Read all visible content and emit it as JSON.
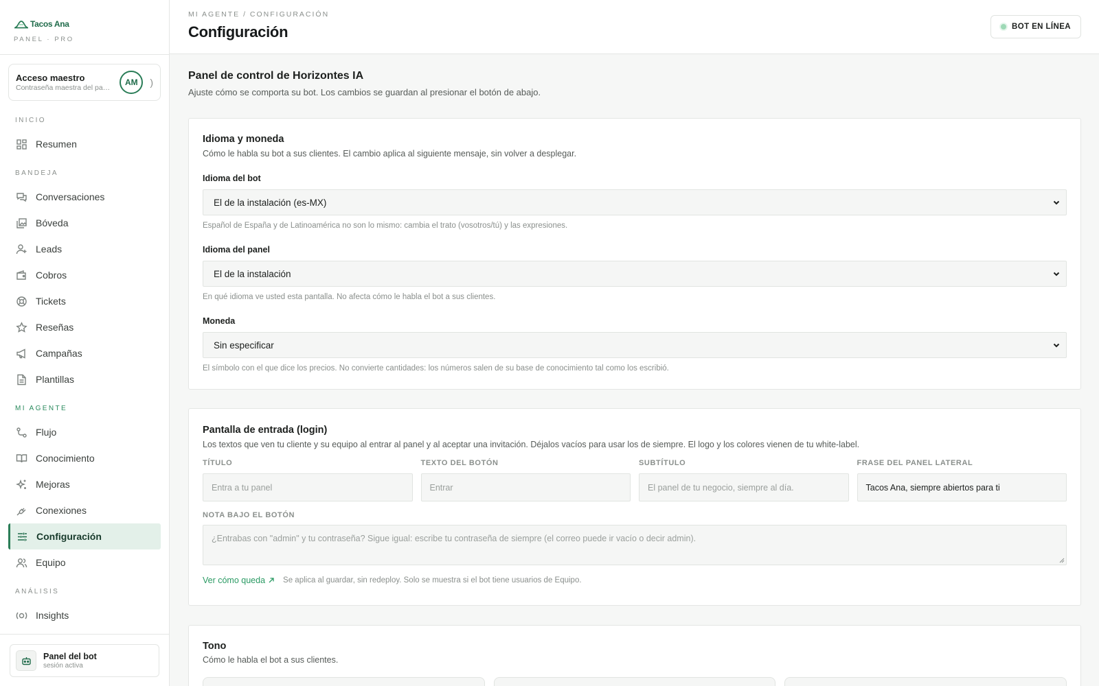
{
  "brand": {
    "name": "Tacos Ana",
    "subtitle": "PANEL · PRO"
  },
  "master_access": {
    "title": "Acceso maestro",
    "subtitle": "Contraseña maestra del panel",
    "initials": "AM",
    "trailing": ")"
  },
  "nav": {
    "sections": [
      {
        "label": "INICIO",
        "items": [
          {
            "label": "Resumen",
            "icon": "grid-icon"
          }
        ]
      },
      {
        "label": "BANDEJA",
        "items": [
          {
            "label": "Conversaciones",
            "icon": "chat-icon"
          },
          {
            "label": "Bóveda",
            "icon": "gallery-icon"
          },
          {
            "label": "Leads",
            "icon": "user-plus-icon"
          },
          {
            "label": "Cobros",
            "icon": "wallet-icon"
          },
          {
            "label": "Tickets",
            "icon": "lifebuoy-icon"
          },
          {
            "label": "Reseñas",
            "icon": "star-icon"
          },
          {
            "label": "Campañas",
            "icon": "megaphone-icon"
          },
          {
            "label": "Plantillas",
            "icon": "document-icon"
          }
        ]
      },
      {
        "label": "MI AGENTE",
        "items": [
          {
            "label": "Flujo",
            "icon": "flow-icon"
          },
          {
            "label": "Conocimiento",
            "icon": "book-icon"
          },
          {
            "label": "Mejoras",
            "icon": "sparkles-icon"
          },
          {
            "label": "Conexiones",
            "icon": "plug-icon"
          },
          {
            "label": "Configuración",
            "icon": "sliders-icon",
            "active": true
          },
          {
            "label": "Equipo",
            "icon": "team-icon"
          }
        ]
      },
      {
        "label": "ANÁLISIS",
        "items": [
          {
            "label": "Insights",
            "icon": "insights-icon"
          }
        ]
      }
    ]
  },
  "footer_card": {
    "title": "Panel del bot",
    "subtitle": "sesión activa"
  },
  "header": {
    "breadcrumb": "MI AGENTE / CONFIGURACIÓN",
    "title": "Configuración",
    "status": "BOT EN LÍNEA"
  },
  "intro": {
    "title": "Panel de control de Horizontes IA",
    "subtitle": "Ajuste cómo se comporta su bot. Los cambios se guardan al presionar el botón de abajo."
  },
  "language_card": {
    "title": "Idioma y moneda",
    "description": "Cómo le habla su bot a sus clientes. El cambio aplica al siguiente mensaje, sin volver a desplegar.",
    "fields": [
      {
        "label": "Idioma del bot",
        "value": "El de la instalación (es-MX)",
        "hint": "Español de España y de Latinoamérica no son lo mismo: cambia el trato (vosotros/tú) y las expresiones."
      },
      {
        "label": "Idioma del panel",
        "value": "El de la instalación",
        "hint": "En qué idioma ve usted esta pantalla. No afecta cómo le habla el bot a sus clientes."
      },
      {
        "label": "Moneda",
        "value": "Sin especificar",
        "hint": "El símbolo con el que dice los precios. No convierte cantidades: los números salen de su base de conocimiento tal como los escribió."
      }
    ]
  },
  "login_card": {
    "title": "Pantalla de entrada (login)",
    "description": "Los textos que ven tu cliente y su equipo al entrar al panel y al aceptar una invitación. Déjalos vacíos para usar los de siempre. El logo y los colores vienen de tu white-label.",
    "fields": [
      {
        "label": "TÍTULO",
        "placeholder": "Entra a tu panel",
        "value": ""
      },
      {
        "label": "TEXTO DEL BOTÓN",
        "placeholder": "Entrar",
        "value": ""
      },
      {
        "label": "SUBTÍTULO",
        "placeholder": "El panel de tu negocio, siempre al día.",
        "value": ""
      },
      {
        "label": "FRASE DEL PANEL LATERAL",
        "placeholder": "",
        "value": "Tacos Ana, siempre abiertos para ti"
      }
    ],
    "note": {
      "label": "NOTA BAJO EL BOTÓN",
      "placeholder": "¿Entrabas con \"admin\" y tu contraseña? Sigue igual: escribe tu contraseña de siempre (el correo puede ir vacío o decir admin)."
    },
    "preview_link": "Ver cómo queda",
    "footnote": "Se aplica al guardar, sin redeploy. Solo se muestra si el bot tiene usuarios de Equipo."
  },
  "tone_card": {
    "title": "Tono",
    "description": "Cómo le habla el bot a sus clientes."
  },
  "colors": {
    "accent": "#2a7d57",
    "link": "#2a9a63",
    "active_bg": "#e3f0e9"
  }
}
